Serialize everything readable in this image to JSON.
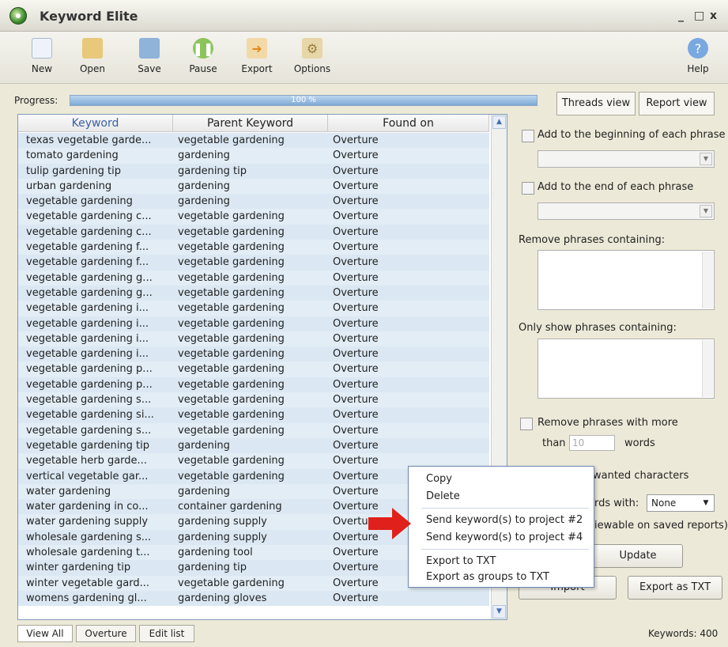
{
  "window": {
    "title": "Keyword Elite",
    "controls": [
      "_",
      "□",
      "x"
    ]
  },
  "toolbar": {
    "buttons": [
      {
        "label": "New",
        "icon": "new-icon",
        "color": "#dfe8f5"
      },
      {
        "label": "Open",
        "icon": "open-folder-icon",
        "color": "#e8c87a"
      },
      {
        "label": "Save",
        "icon": "save-icon",
        "color": "#8fb3d9"
      },
      {
        "label": "Pause",
        "icon": "pause-icon",
        "color": "#8cc45c"
      },
      {
        "label": "Export",
        "icon": "export-icon",
        "color": "#f0b060"
      },
      {
        "label": "Options",
        "icon": "options-icon",
        "color": "#d8c28a"
      },
      {
        "label": "Help",
        "icon": "help-icon",
        "color": "#7aa8e0"
      }
    ]
  },
  "progress": {
    "label": "Progress:",
    "text": "100 %",
    "value": 100
  },
  "view_tabs": {
    "threads": "Threads view",
    "report": "Report view"
  },
  "table": {
    "columns": [
      "Keyword",
      "Parent Keyword",
      "Found on"
    ],
    "rows": [
      [
        "texas vegetable garde...",
        "vegetable gardening",
        "Overture"
      ],
      [
        "tomato gardening",
        "gardening",
        "Overture"
      ],
      [
        "tulip gardening tip",
        "gardening tip",
        "Overture"
      ],
      [
        "urban gardening",
        "gardening",
        "Overture"
      ],
      [
        "vegetable gardening",
        "gardening",
        "Overture"
      ],
      [
        "vegetable gardening c...",
        "vegetable gardening",
        "Overture"
      ],
      [
        "vegetable gardening c...",
        "vegetable gardening",
        "Overture"
      ],
      [
        "vegetable gardening f...",
        "vegetable gardening",
        "Overture"
      ],
      [
        "vegetable gardening f...",
        "vegetable gardening",
        "Overture"
      ],
      [
        "vegetable gardening g...",
        "vegetable gardening",
        "Overture"
      ],
      [
        "vegetable gardening g...",
        "vegetable gardening",
        "Overture"
      ],
      [
        "vegetable gardening i...",
        "vegetable gardening",
        "Overture"
      ],
      [
        "vegetable gardening i...",
        "vegetable gardening",
        "Overture"
      ],
      [
        "vegetable gardening i...",
        "vegetable gardening",
        "Overture"
      ],
      [
        "vegetable gardening i...",
        "vegetable gardening",
        "Overture"
      ],
      [
        "vegetable gardening p...",
        "vegetable gardening",
        "Overture"
      ],
      [
        "vegetable gardening p...",
        "vegetable gardening",
        "Overture"
      ],
      [
        "vegetable gardening s...",
        "vegetable gardening",
        "Overture"
      ],
      [
        "vegetable gardening si...",
        "vegetable gardening",
        "Overture"
      ],
      [
        "vegetable gardening s...",
        "vegetable gardening",
        "Overture"
      ],
      [
        "vegetable gardening tip",
        "gardening",
        "Overture"
      ],
      [
        "vegetable herb garde...",
        "vegetable gardening",
        "Overture"
      ],
      [
        "vertical vegetable gar...",
        "vegetable gardening",
        "Overture"
      ],
      [
        "water gardening",
        "gardening",
        "Overture"
      ],
      [
        "water gardening in co...",
        "container gardening",
        "Overture"
      ],
      [
        "water gardening supply",
        "gardening supply",
        "Overture"
      ],
      [
        "wholesale gardening s...",
        "gardening supply",
        "Overture"
      ],
      [
        "wholesale gardening t...",
        "gardening tool",
        "Overture"
      ],
      [
        "winter gardening tip",
        "gardening tip",
        "Overture"
      ],
      [
        "winter vegetable gard...",
        "vegetable gardening",
        "Overture"
      ],
      [
        "womens gardening gl...",
        "gardening gloves",
        "Overture"
      ]
    ]
  },
  "bottom_tabs": [
    "View All",
    "Overture",
    "Edit list"
  ],
  "keyword_count": "Keywords: 400",
  "right_panel": {
    "add_beginning": "Add to the beginning of each phrase",
    "add_end": "Add to the end of each phrase",
    "remove_containing": "Remove phrases containing:",
    "only_show": "Only show phrases containing:",
    "remove_more_than": "Remove phrases with more",
    "than": "than",
    "words_value": "10",
    "words": "words",
    "unwanted_chars": "wanted characters",
    "rds_with": "rds with:",
    "select_value": "None",
    "viewable": "iewable on saved reports)",
    "update_button": "Update",
    "import_button": "Import",
    "export_txt_button": "Export as TXT"
  },
  "context_menu": {
    "items": [
      "Copy",
      "Delete",
      "Send keyword(s) to project #2",
      "Send keyword(s) to project #4",
      "Export to TXT",
      "Export as groups to TXT"
    ]
  },
  "colors": {
    "arrow": "#e0201a",
    "progress": "#7fa9d6",
    "header_text": "#3a5fa8"
  }
}
